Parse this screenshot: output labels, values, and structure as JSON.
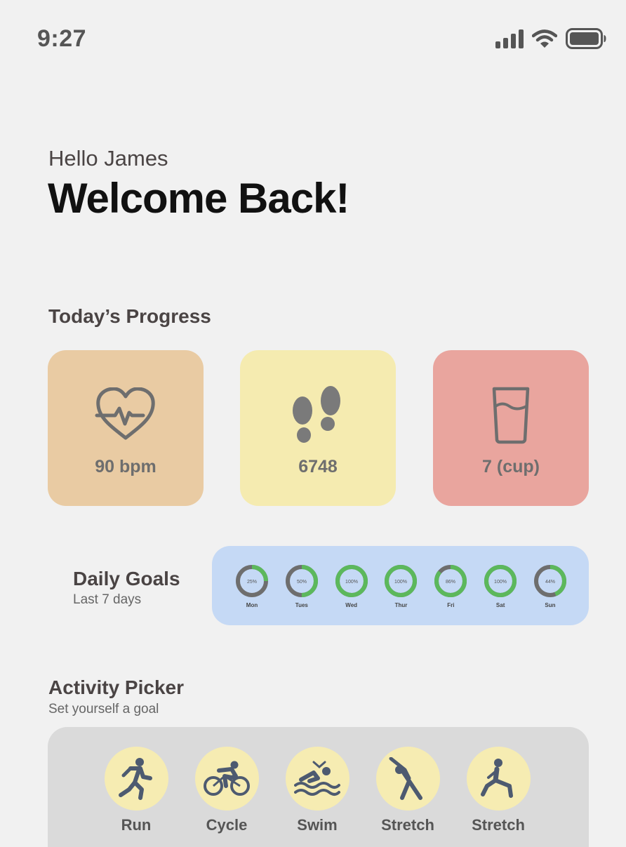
{
  "status_bar": {
    "time": "9:27"
  },
  "header": {
    "greeting": "Hello James",
    "headline": "Welcome Back!"
  },
  "progress": {
    "title": "Today’s Progress",
    "tiles": [
      {
        "value": "90 bpm",
        "icon": "heart-rate-icon",
        "color": "#e9cba3"
      },
      {
        "value": "6748",
        "icon": "footsteps-icon",
        "color": "#f5ebb0"
      },
      {
        "value": "7 (cup)",
        "icon": "water-glass-icon",
        "color": "#e9a59e"
      }
    ]
  },
  "daily_goals": {
    "title": "Daily Goals",
    "subtitle": "Last 7 days",
    "card_color": "#c5d9f5",
    "ring_colors": {
      "progress": "#5cb85c",
      "track": "#6e6e6e"
    },
    "days": [
      {
        "day": "Mon",
        "label": "25%",
        "fraction": 0.25
      },
      {
        "day": "Tues",
        "label": "50%",
        "fraction": 0.5
      },
      {
        "day": "Wed",
        "label": "100%",
        "fraction": 1.0
      },
      {
        "day": "Thur",
        "label": "100%",
        "fraction": 1.0
      },
      {
        "day": "Fri",
        "label": "86%",
        "fraction": 0.86
      },
      {
        "day": "Sat",
        "label": "100%",
        "fraction": 1.0
      },
      {
        "day": "Sun",
        "label": "44%",
        "fraction": 0.44
      }
    ]
  },
  "activity_picker": {
    "title": "Activity Picker",
    "subtitle": "Set yourself a goal",
    "activities": [
      {
        "label": "Run",
        "icon": "running-icon"
      },
      {
        "label": "Cycle",
        "icon": "cycling-icon"
      },
      {
        "label": "Swim",
        "icon": "swimming-icon"
      },
      {
        "label": "Stretch",
        "icon": "side-stretch-icon"
      },
      {
        "label": "Stretch",
        "icon": "lunge-stretch-icon"
      }
    ]
  }
}
